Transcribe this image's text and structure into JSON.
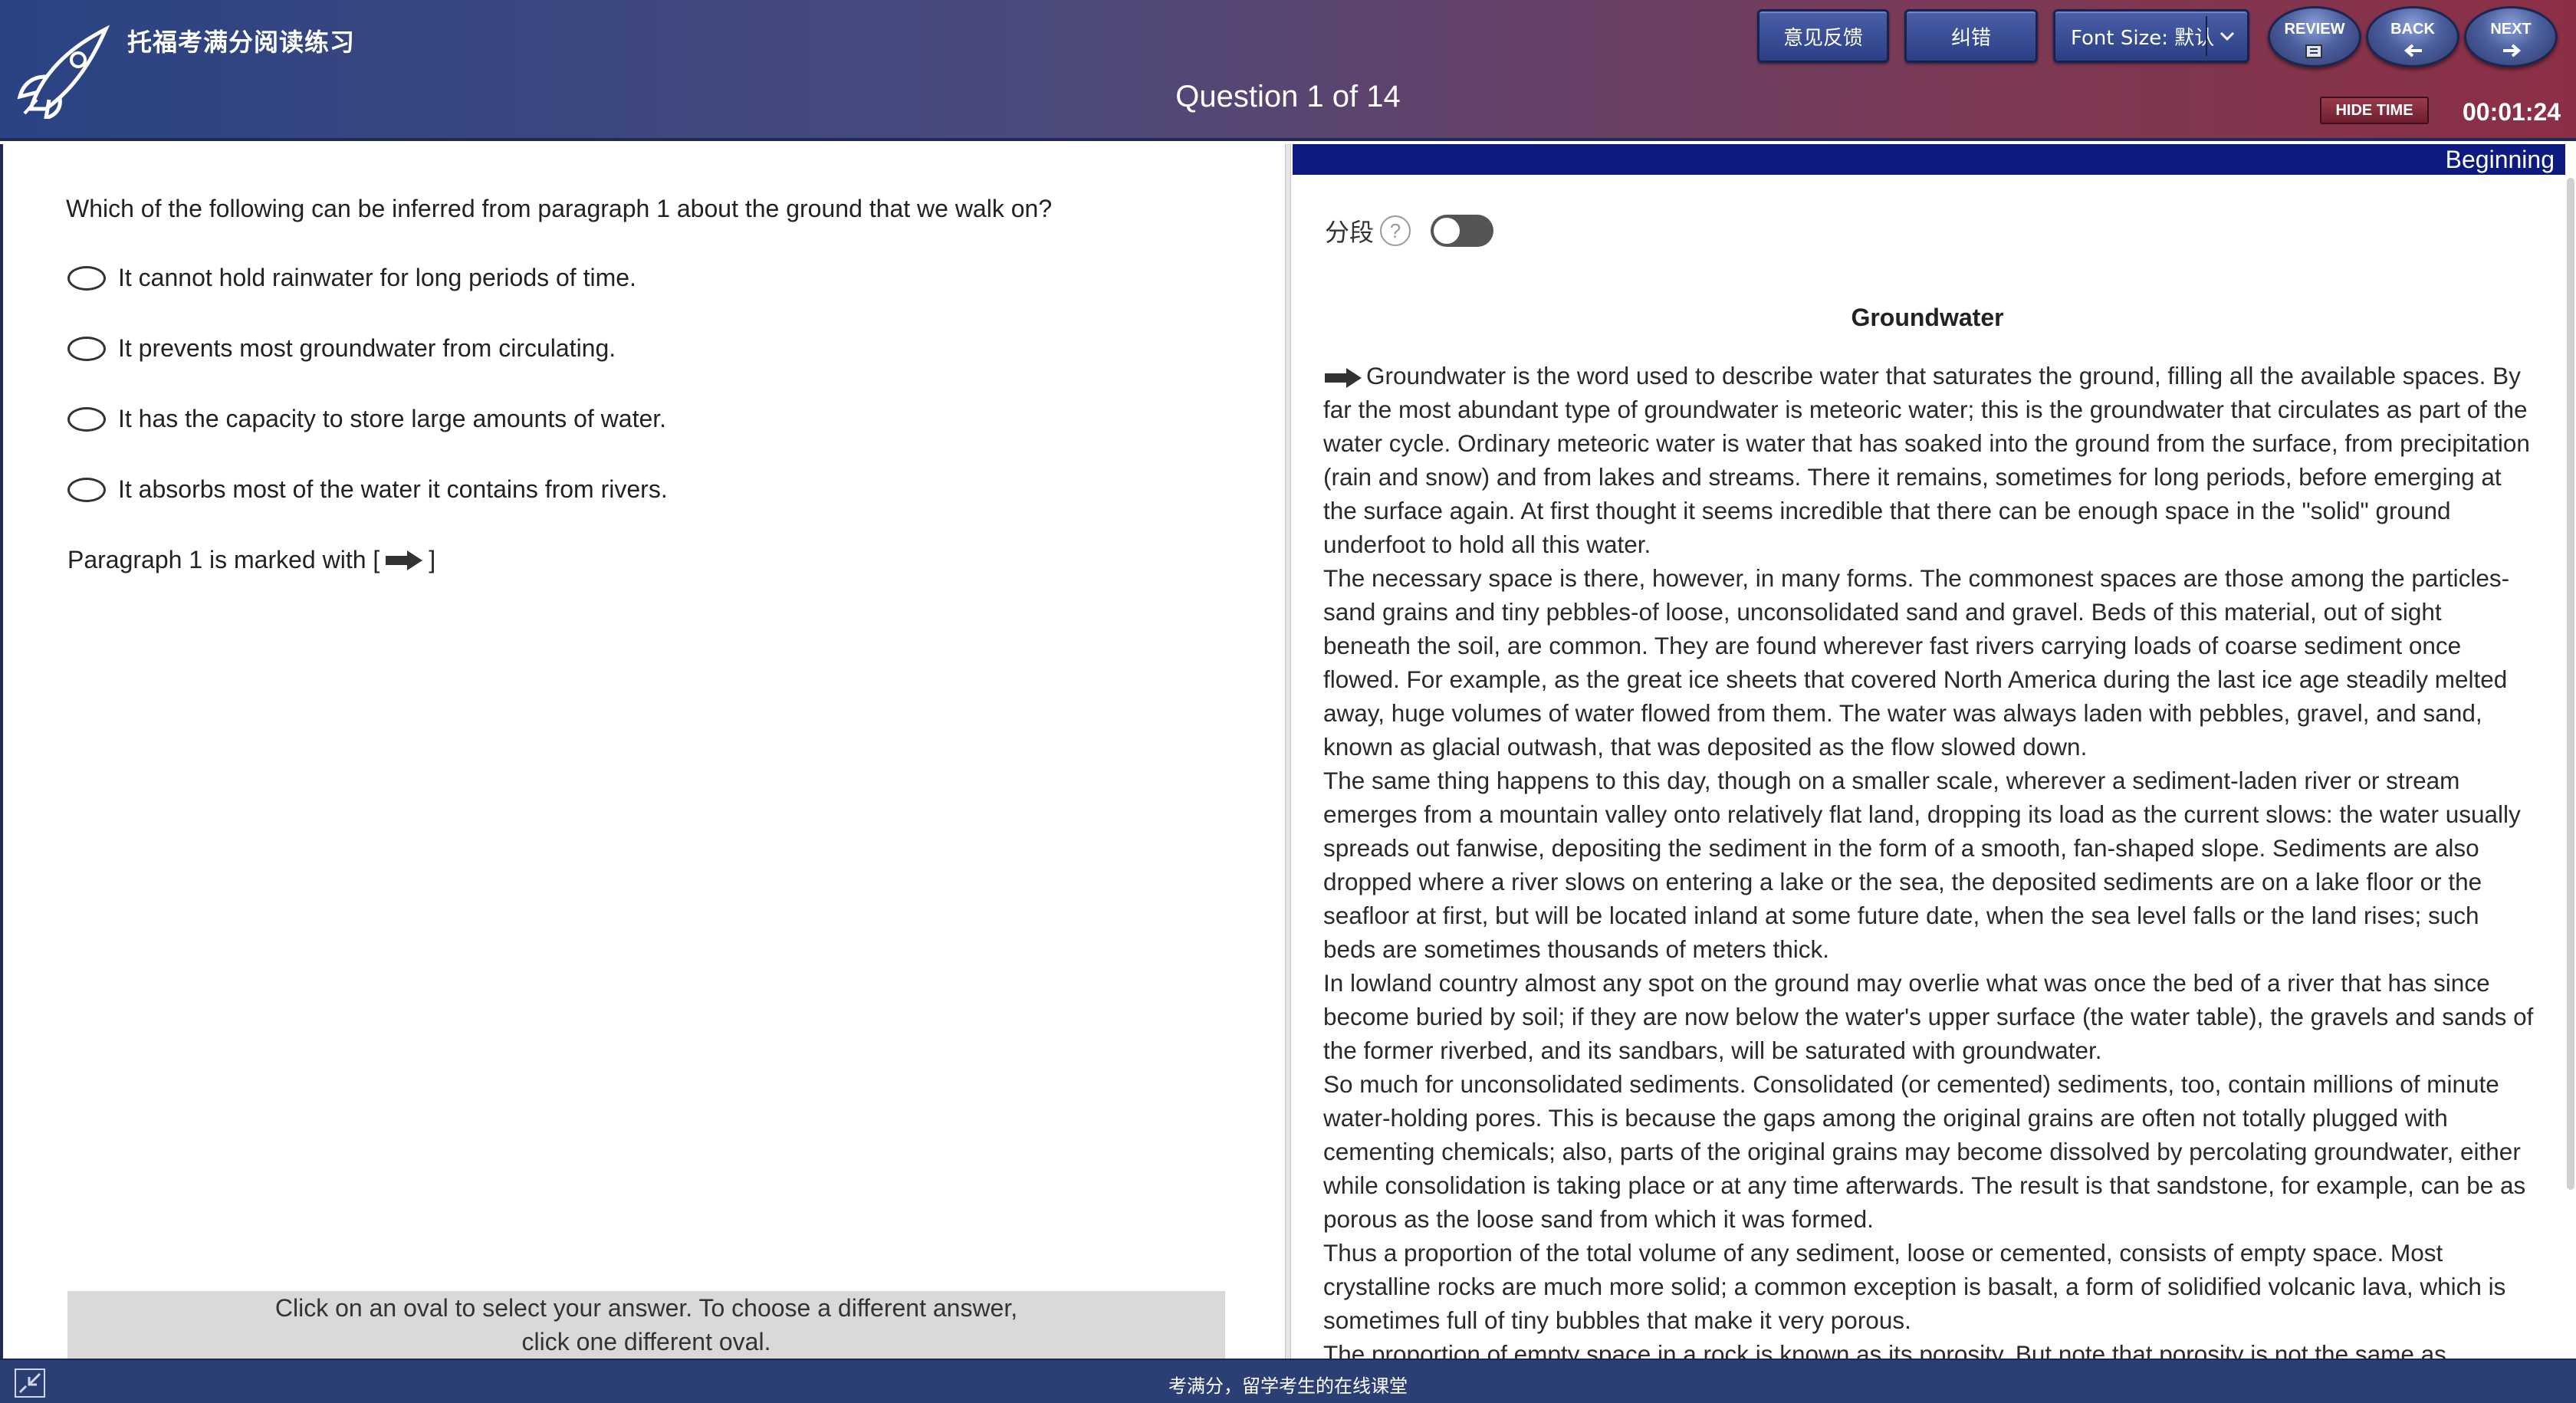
{
  "header": {
    "app_title": "托福考满分阅读练习",
    "question_counter": "Question 1 of 14",
    "feedback_label": "意见反馈",
    "correction_label": "纠错",
    "font_size_label": "Font Size: 默认",
    "review_label": "REVIEW",
    "back_label": "BACK",
    "next_label": "NEXT",
    "hide_time_label": "HIDE TIME",
    "timer": "00:01:24"
  },
  "question": {
    "text": "Which of the following can be inferred from paragraph 1 about the ground that we walk on?",
    "options": [
      "It cannot hold rainwater for long periods of time.",
      "It prevents most groundwater from circulating.",
      "It has the capacity to store large amounts of water.",
      "It absorbs most of the water it contains from rivers."
    ],
    "paragraph_note_prefix": "Paragraph 1 is marked with [",
    "paragraph_note_suffix": "]",
    "instructions_line1": "Click on an oval to select your answer. To choose a different answer,",
    "instructions_line2": "click one different oval."
  },
  "passage": {
    "position_label": "Beginning",
    "segment_label": "分段",
    "segment_help": "?",
    "title": "Groundwater",
    "paragraphs": [
      "Groundwater is the word used to describe water that saturates the ground, filling all the available spaces. By far the most abundant type of groundwater is meteoric water; this is the groundwater that circulates as part of the water cycle. Ordinary meteoric water is water that has soaked into the ground from the surface, from precipitation (rain and snow) and from lakes and streams. There it remains, sometimes for long periods, before emerging at the surface again. At first thought it seems incredible that there can be enough space in the \"solid\" ground underfoot to hold all this water.",
      "The necessary space is there, however, in many forms. The commonest spaces are those among the particles-sand grains and tiny pebbles-of loose, unconsolidated sand and gravel. Beds of this material, out of sight beneath the soil, are common. They are found wherever fast rivers carrying loads of coarse sediment once flowed. For example, as the great ice sheets that covered North America during the last ice age steadily melted away, huge volumes of water flowed from them. The water was always laden with pebbles, gravel, and sand, known as glacial outwash, that was deposited as the flow slowed down.",
      "The same thing happens to this day, though on a smaller scale, wherever a sediment-laden river or stream emerges from a mountain valley onto relatively flat land, dropping its load as the current slows: the water usually spreads out fanwise, depositing the sediment in the form of a smooth, fan-shaped slope. Sediments are also dropped where a river slows on entering a lake or the sea, the deposited sediments are on a lake floor or the seafloor at first, but will be located inland at some future date, when the sea level falls or the land rises; such beds are sometimes thousands of meters thick.",
      "In lowland country almost any spot on the ground may overlie what was once the bed of a river that has since become buried by soil; if they are now below the water's upper surface (the water table), the gravels and sands of the former riverbed, and its sandbars, will be saturated with groundwater.",
      "So much for unconsolidated sediments. Consolidated (or cemented) sediments, too, contain millions of minute water-holding pores. This is because the gaps among the original grains are often not totally plugged with cementing chemicals; also, parts of the original grains may become dissolved by percolating groundwater, either while consolidation is taking place or at any time afterwards. The result is that sandstone, for example, can be as porous as the loose sand from which it was formed.",
      "Thus a proportion of the total volume of any sediment, loose or cemented, consists of empty space. Most crystalline rocks are much more solid; a common exception is basalt, a form of solidified volcanic lava, which is sometimes full of tiny bubbles that make it very porous.",
      "The proportion of empty space in a rock is known as its porosity. But note that porosity is not the same as"
    ]
  },
  "footer": {
    "text": "考满分，留学考生的在线课堂"
  }
}
